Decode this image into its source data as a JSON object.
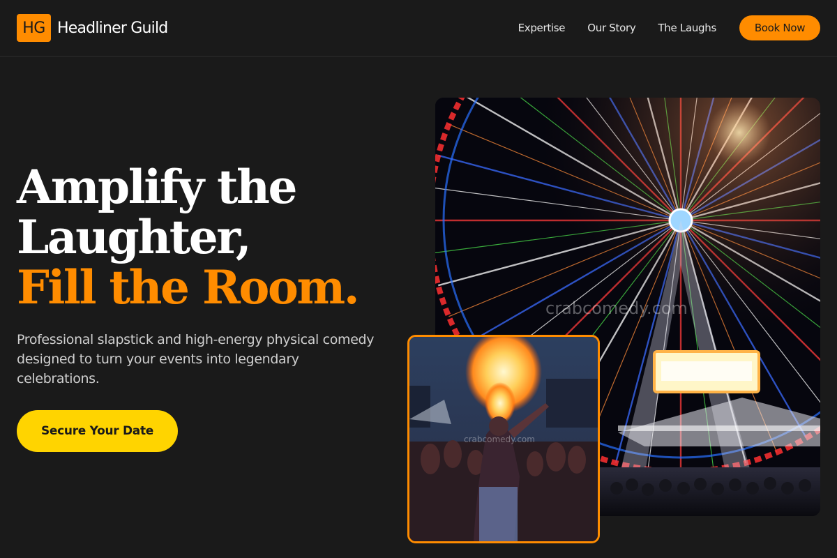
{
  "header": {
    "logo_text": "HG",
    "brand_name": "Headliner Guild",
    "nav": [
      "Expertise",
      "Our Story",
      "The Laughs"
    ],
    "book_label": "Book Now"
  },
  "hero": {
    "title_line1": "Amplify the",
    "title_line2": "Laughter,",
    "title_accent": "Fill the Room.",
    "subtitle": "Professional slapstick and high-energy physical comedy designed to turn your events into legendary celebrations.",
    "cta_label": "Secure Your Date"
  },
  "images": {
    "main_watermark": "crabcomedy.com",
    "inset_watermark": "crabcomedy.com"
  },
  "colors": {
    "background": "#1a1a1a",
    "accent_orange": "#ff8c00",
    "cta_yellow": "#ffd400"
  }
}
